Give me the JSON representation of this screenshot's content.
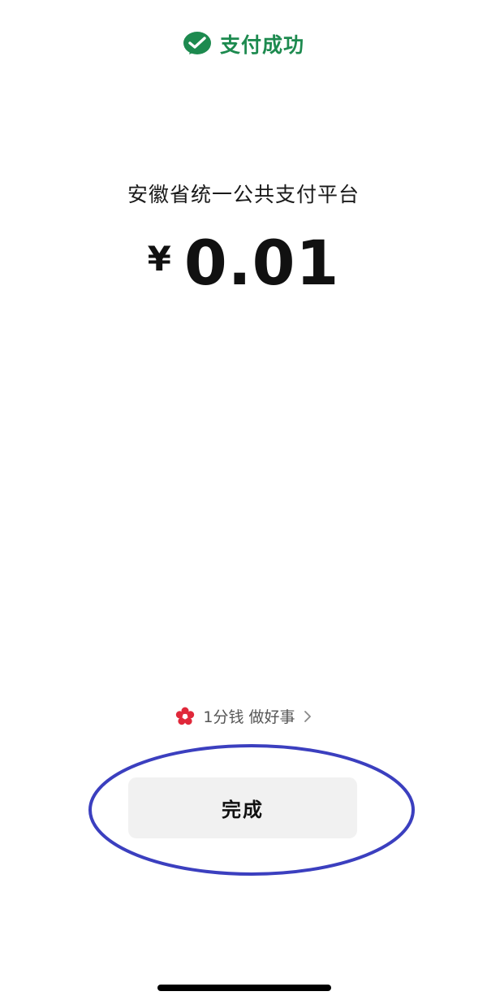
{
  "header": {
    "icon": "wechat-pay-icon",
    "status": "支付成功",
    "accent_color": "#1d8a4f"
  },
  "payment": {
    "merchant": "安徽省统一公共支付平台",
    "currency_symbol": "¥",
    "amount": "0.01"
  },
  "charity": {
    "icon": "flower-icon",
    "label": "1分钱 做好事",
    "icon_color": "#e0283a"
  },
  "actions": {
    "done_label": "完成"
  },
  "annotation": {
    "shape": "ellipse",
    "color": "#3b3fbf"
  }
}
